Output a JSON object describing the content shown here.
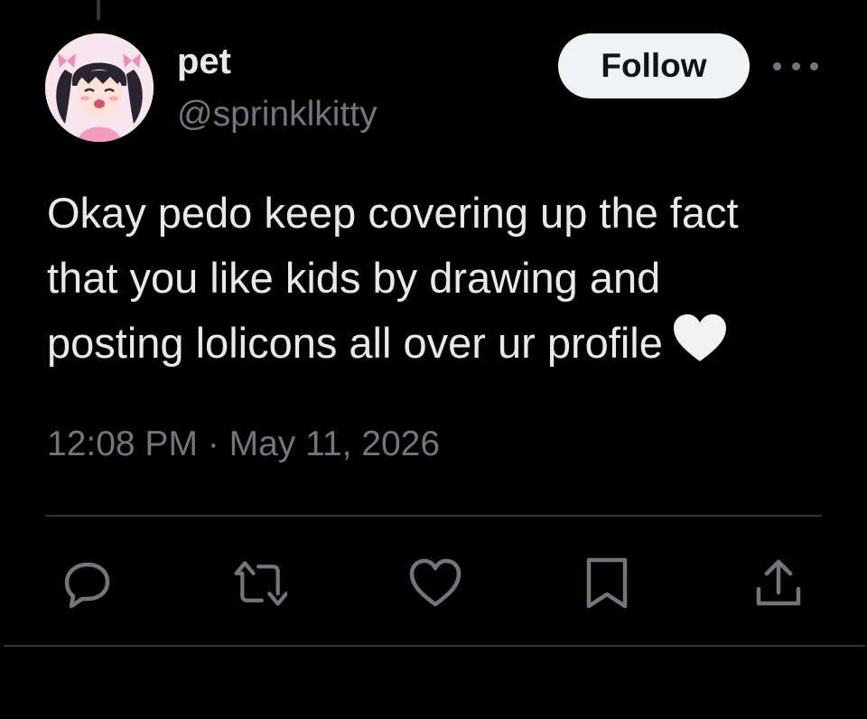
{
  "author": {
    "display_name": "pet",
    "handle": "@sprinklkitty",
    "avatar": "anime-girl-avatar"
  },
  "follow_label": "Follow",
  "tweet": {
    "lines": [
      "Okay pedo keep covering up the fact",
      "that you like kids by drawing and",
      "posting lolicons all over ur profile"
    ],
    "emoji": "white-heart",
    "timestamp": "12:08 PM · May 11, 2026"
  },
  "actions": [
    {
      "name": "reply",
      "icon": "reply-icon"
    },
    {
      "name": "retweet",
      "icon": "retweet-icon"
    },
    {
      "name": "like",
      "icon": "heart-icon"
    },
    {
      "name": "bookmark",
      "icon": "bookmark-icon"
    },
    {
      "name": "share",
      "icon": "share-icon"
    }
  ],
  "colors": {
    "background": "#000000",
    "text_primary": "#e7e9ea",
    "text_secondary": "#71767b",
    "follow_bg": "#eff3f4",
    "divider": "#2f3336"
  }
}
